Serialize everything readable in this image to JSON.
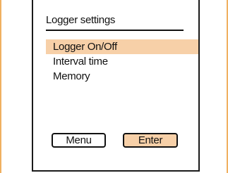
{
  "screen": {
    "title": "Logger settings"
  },
  "menu": {
    "items": [
      {
        "label": "Logger On/Off",
        "selected": true
      },
      {
        "label": "Interval time",
        "selected": false
      },
      {
        "label": "Memory",
        "selected": false
      }
    ]
  },
  "buttons": {
    "menu_label": "Menu",
    "enter_label": "Enter"
  },
  "colors": {
    "highlight": "#f7d0a8",
    "frame_accent": "#f0b060",
    "border": "#111111"
  }
}
